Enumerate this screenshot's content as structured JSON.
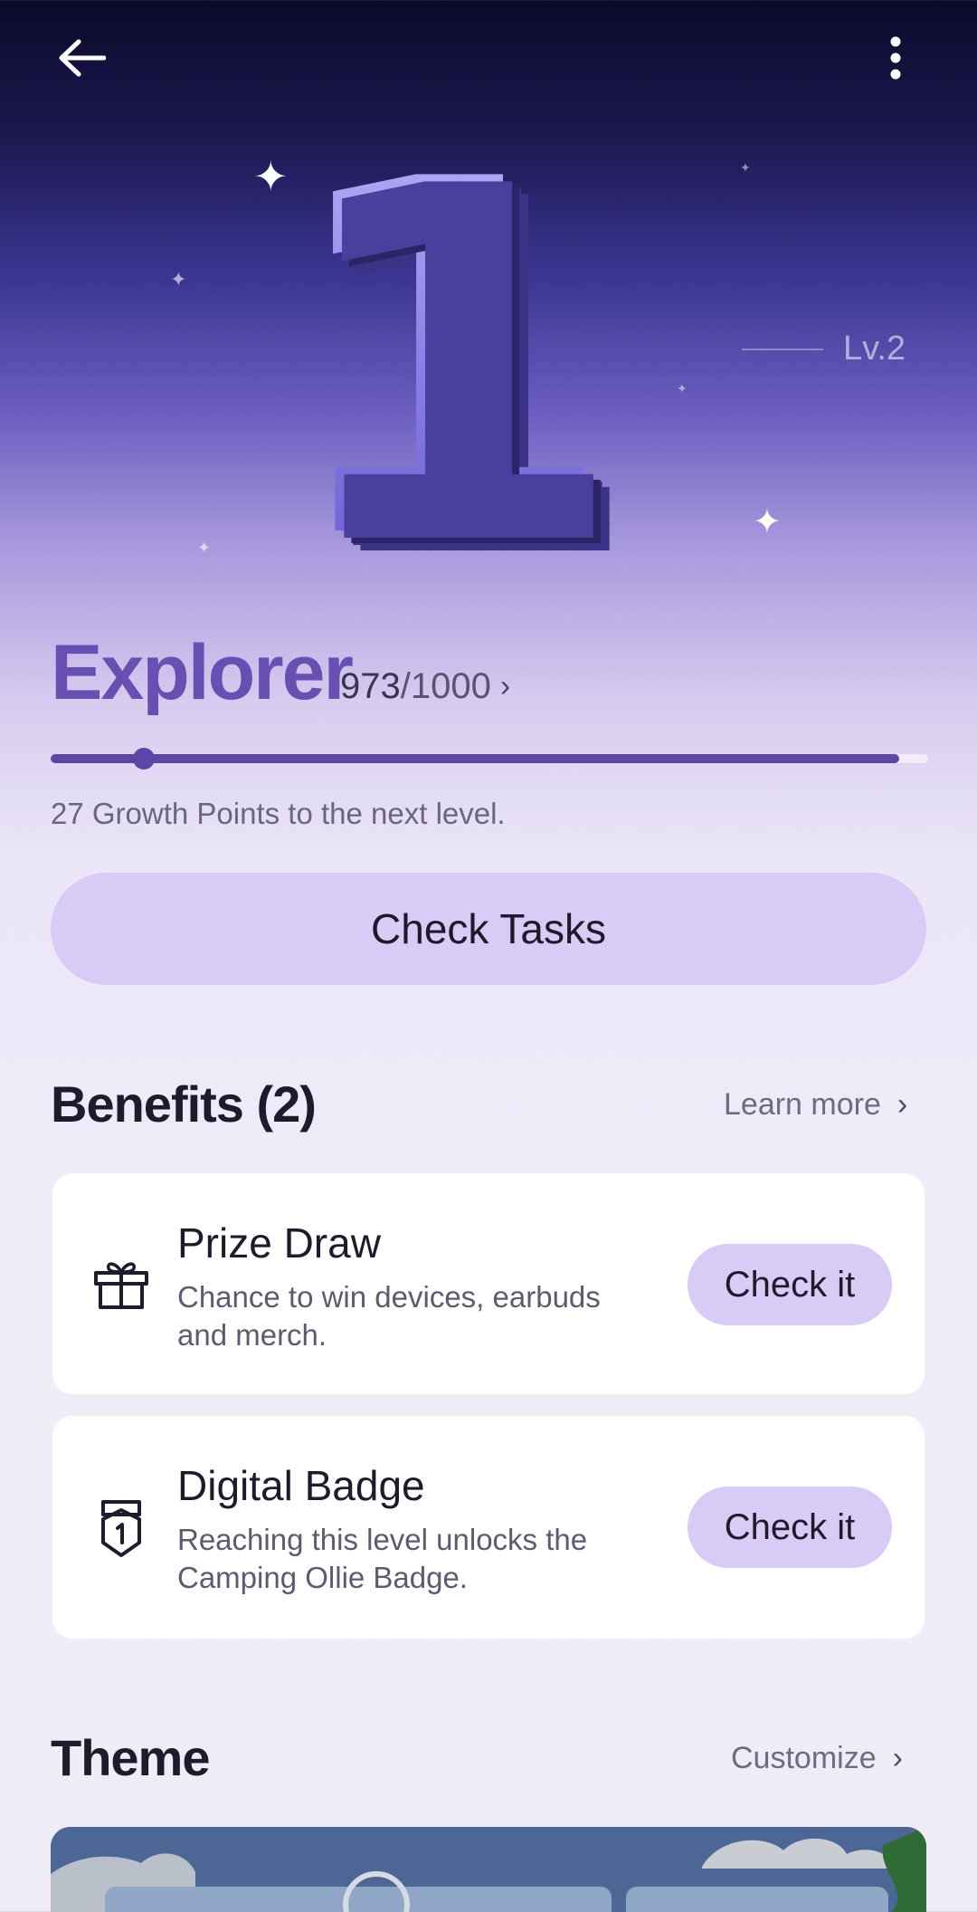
{
  "topbar": {
    "back_icon": "arrow-left-icon",
    "more_icon": "more-vertical-icon"
  },
  "hero": {
    "level_number": "1",
    "next_level": "Lv.2"
  },
  "level": {
    "title": "Explorer",
    "points_current": "973",
    "points_total": "/1000",
    "progress": 0.973,
    "hint": "27 Growth Points to the next level."
  },
  "actions": {
    "check_tasks": "Check Tasks"
  },
  "benefits": {
    "title": "Benefits (2)",
    "link": "Learn more",
    "items": [
      {
        "icon": "gift-icon",
        "title": "Prize Draw",
        "description": "Chance to win devices, earbuds and merch.",
        "button": "Check it"
      },
      {
        "icon": "badge-icon",
        "title": "Digital Badge",
        "description": "Reaching this level unlocks the Camping Ollie Badge.",
        "button": "Check it"
      }
    ]
  },
  "theme": {
    "title": "Theme",
    "link": "Customize"
  },
  "colors": {
    "accent": "#5d46a6",
    "button_bg": "#d8cbf5",
    "title_purple": "#6a4fb2"
  }
}
